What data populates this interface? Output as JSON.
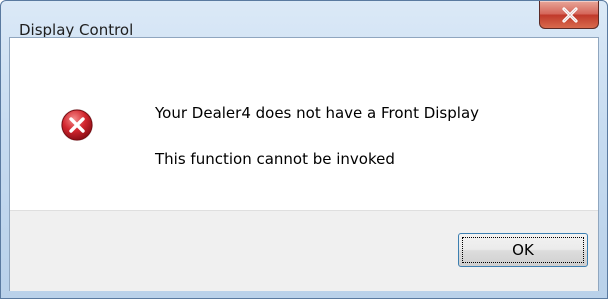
{
  "window": {
    "title": "Display Control"
  },
  "titlebar": {
    "close_icon": "close-icon",
    "close_color": "#c94a3a"
  },
  "message": {
    "icon": "error-icon",
    "icon_color": "#c0202a",
    "line1": "Your Dealer4 does not have a Front Display",
    "line2": "This function cannot be invoked"
  },
  "buttons": {
    "ok_label": "OK"
  }
}
